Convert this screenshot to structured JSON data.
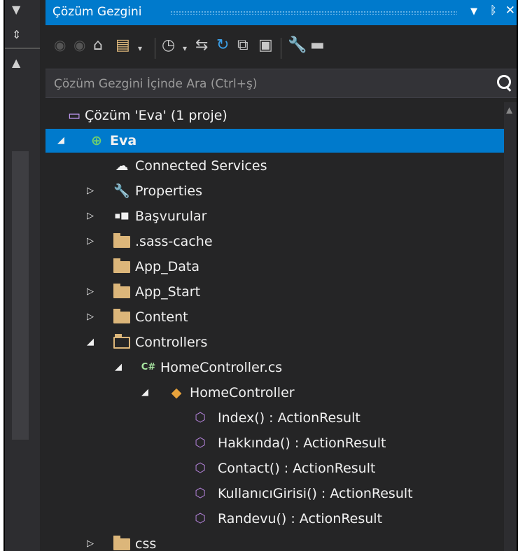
{
  "panel": {
    "title": "Çözüm Gezgini",
    "pin_glyph": "ᛔ",
    "close_glyph": "✕",
    "dropdown_glyph": "▼"
  },
  "search": {
    "placeholder": "Çözüm Gezgini İçinde Ara (Ctrl+ş)"
  },
  "toolbar": {
    "icons": [
      "back-icon",
      "forward-icon",
      "home-icon",
      "switch-views-icon",
      "pending-changes-icon",
      "sync-icon",
      "refresh-icon",
      "collapse-all-icon",
      "show-all-files-icon",
      "properties-icon",
      "preview-icon"
    ]
  },
  "tree": {
    "solution": "Çözüm 'Eva' (1 proje)",
    "project": "Eva",
    "connected_services": "Connected Services",
    "properties": "Properties",
    "references": "Başvurular",
    "sass_cache": ".sass-cache",
    "app_data": "App_Data",
    "app_start": "App_Start",
    "content": "Content",
    "controllers": "Controllers",
    "home_controller_file": "HomeController.cs",
    "home_controller_class": "HomeController",
    "methods": [
      "Index() : ActionResult",
      "Hakkında() : ActionResult",
      "Contact() : ActionResult",
      "KullanıcıGirisi() : ActionResult",
      "Randevu() : ActionResult"
    ],
    "css": "css"
  },
  "colors": {
    "accent": "#007acc",
    "background": "#252526",
    "folder": "#dcb67a",
    "method": "#b180d7"
  }
}
